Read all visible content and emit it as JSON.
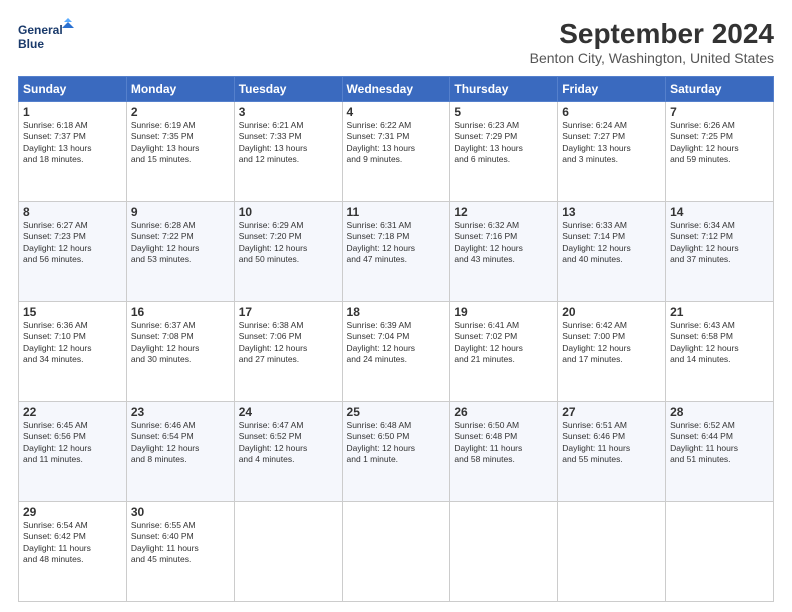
{
  "header": {
    "logo_line1": "General",
    "logo_line2": "Blue",
    "title": "September 2024",
    "subtitle": "Benton City, Washington, United States"
  },
  "weekdays": [
    "Sunday",
    "Monday",
    "Tuesday",
    "Wednesday",
    "Thursday",
    "Friday",
    "Saturday"
  ],
  "weeks": [
    [
      {
        "day": "1",
        "info": "Sunrise: 6:18 AM\nSunset: 7:37 PM\nDaylight: 13 hours\nand 18 minutes."
      },
      {
        "day": "2",
        "info": "Sunrise: 6:19 AM\nSunset: 7:35 PM\nDaylight: 13 hours\nand 15 minutes."
      },
      {
        "day": "3",
        "info": "Sunrise: 6:21 AM\nSunset: 7:33 PM\nDaylight: 13 hours\nand 12 minutes."
      },
      {
        "day": "4",
        "info": "Sunrise: 6:22 AM\nSunset: 7:31 PM\nDaylight: 13 hours\nand 9 minutes."
      },
      {
        "day": "5",
        "info": "Sunrise: 6:23 AM\nSunset: 7:29 PM\nDaylight: 13 hours\nand 6 minutes."
      },
      {
        "day": "6",
        "info": "Sunrise: 6:24 AM\nSunset: 7:27 PM\nDaylight: 13 hours\nand 3 minutes."
      },
      {
        "day": "7",
        "info": "Sunrise: 6:26 AM\nSunset: 7:25 PM\nDaylight: 12 hours\nand 59 minutes."
      }
    ],
    [
      {
        "day": "8",
        "info": "Sunrise: 6:27 AM\nSunset: 7:23 PM\nDaylight: 12 hours\nand 56 minutes."
      },
      {
        "day": "9",
        "info": "Sunrise: 6:28 AM\nSunset: 7:22 PM\nDaylight: 12 hours\nand 53 minutes."
      },
      {
        "day": "10",
        "info": "Sunrise: 6:29 AM\nSunset: 7:20 PM\nDaylight: 12 hours\nand 50 minutes."
      },
      {
        "day": "11",
        "info": "Sunrise: 6:31 AM\nSunset: 7:18 PM\nDaylight: 12 hours\nand 47 minutes."
      },
      {
        "day": "12",
        "info": "Sunrise: 6:32 AM\nSunset: 7:16 PM\nDaylight: 12 hours\nand 43 minutes."
      },
      {
        "day": "13",
        "info": "Sunrise: 6:33 AM\nSunset: 7:14 PM\nDaylight: 12 hours\nand 40 minutes."
      },
      {
        "day": "14",
        "info": "Sunrise: 6:34 AM\nSunset: 7:12 PM\nDaylight: 12 hours\nand 37 minutes."
      }
    ],
    [
      {
        "day": "15",
        "info": "Sunrise: 6:36 AM\nSunset: 7:10 PM\nDaylight: 12 hours\nand 34 minutes."
      },
      {
        "day": "16",
        "info": "Sunrise: 6:37 AM\nSunset: 7:08 PM\nDaylight: 12 hours\nand 30 minutes."
      },
      {
        "day": "17",
        "info": "Sunrise: 6:38 AM\nSunset: 7:06 PM\nDaylight: 12 hours\nand 27 minutes."
      },
      {
        "day": "18",
        "info": "Sunrise: 6:39 AM\nSunset: 7:04 PM\nDaylight: 12 hours\nand 24 minutes."
      },
      {
        "day": "19",
        "info": "Sunrise: 6:41 AM\nSunset: 7:02 PM\nDaylight: 12 hours\nand 21 minutes."
      },
      {
        "day": "20",
        "info": "Sunrise: 6:42 AM\nSunset: 7:00 PM\nDaylight: 12 hours\nand 17 minutes."
      },
      {
        "day": "21",
        "info": "Sunrise: 6:43 AM\nSunset: 6:58 PM\nDaylight: 12 hours\nand 14 minutes."
      }
    ],
    [
      {
        "day": "22",
        "info": "Sunrise: 6:45 AM\nSunset: 6:56 PM\nDaylight: 12 hours\nand 11 minutes."
      },
      {
        "day": "23",
        "info": "Sunrise: 6:46 AM\nSunset: 6:54 PM\nDaylight: 12 hours\nand 8 minutes."
      },
      {
        "day": "24",
        "info": "Sunrise: 6:47 AM\nSunset: 6:52 PM\nDaylight: 12 hours\nand 4 minutes."
      },
      {
        "day": "25",
        "info": "Sunrise: 6:48 AM\nSunset: 6:50 PM\nDaylight: 12 hours\nand 1 minute."
      },
      {
        "day": "26",
        "info": "Sunrise: 6:50 AM\nSunset: 6:48 PM\nDaylight: 11 hours\nand 58 minutes."
      },
      {
        "day": "27",
        "info": "Sunrise: 6:51 AM\nSunset: 6:46 PM\nDaylight: 11 hours\nand 55 minutes."
      },
      {
        "day": "28",
        "info": "Sunrise: 6:52 AM\nSunset: 6:44 PM\nDaylight: 11 hours\nand 51 minutes."
      }
    ],
    [
      {
        "day": "29",
        "info": "Sunrise: 6:54 AM\nSunset: 6:42 PM\nDaylight: 11 hours\nand 48 minutes."
      },
      {
        "day": "30",
        "info": "Sunrise: 6:55 AM\nSunset: 6:40 PM\nDaylight: 11 hours\nand 45 minutes."
      },
      {
        "day": "",
        "info": ""
      },
      {
        "day": "",
        "info": ""
      },
      {
        "day": "",
        "info": ""
      },
      {
        "day": "",
        "info": ""
      },
      {
        "day": "",
        "info": ""
      }
    ]
  ]
}
